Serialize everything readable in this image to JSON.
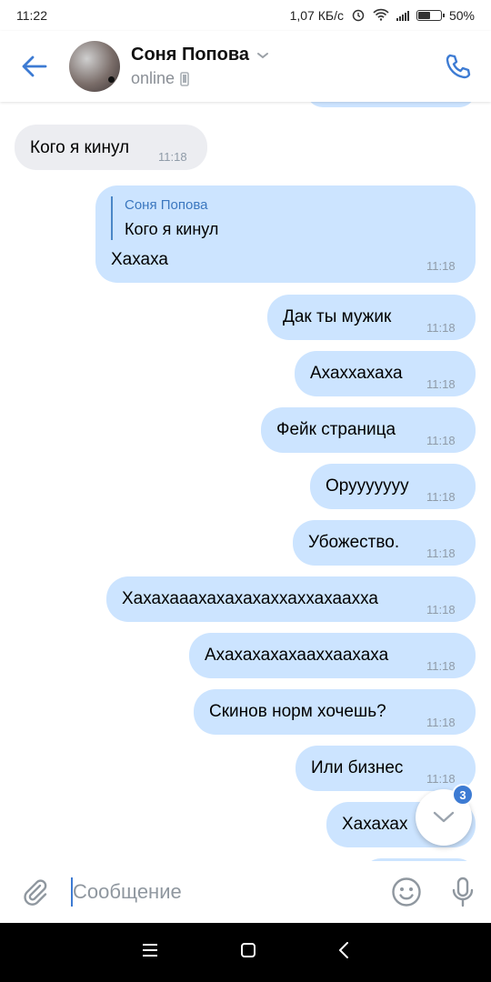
{
  "status_bar": {
    "time": "11:22",
    "speed": "1,07 КБ/с",
    "battery": "50%"
  },
  "header": {
    "name": "Соня Попова",
    "status": "online"
  },
  "messages": [
    {
      "text": "Кого я кинул",
      "time": "11:18",
      "direction": "in"
    },
    {
      "reply_name": "Соня Попова",
      "reply_text": "Кого я кинул",
      "text": "Хахаха",
      "time": "11:18",
      "direction": "out"
    },
    {
      "text": "Дак ты мужик",
      "time": "11:18",
      "direction": "out"
    },
    {
      "text": "Ахаххахаха",
      "time": "11:18",
      "direction": "out"
    },
    {
      "text": "Фейк страница",
      "time": "11:18",
      "direction": "out"
    },
    {
      "text": "Оруууууyy",
      "time": "11:18",
      "direction": "out"
    },
    {
      "text": "Убожество.",
      "time": "11:18",
      "direction": "out"
    },
    {
      "text": "Хахахааахахахахаххаххахаахха",
      "time": "11:18",
      "direction": "out"
    },
    {
      "text": "Ахахахахахааххаахаха",
      "time": "11:18",
      "direction": "out"
    },
    {
      "text": "Скинов норм хочешь?",
      "time": "11:18",
      "direction": "out"
    },
    {
      "text": "Или бизнес",
      "time": "11:18",
      "direction": "out"
    },
    {
      "text": "Хахахах",
      "direction": "out"
    }
  ],
  "scroll_button": {
    "unread_count": "3"
  },
  "composer": {
    "placeholder": "Сообщение"
  },
  "colors": {
    "accent": "#3d7bd3",
    "outgoing_bubble": "#cce4ff",
    "incoming_bubble": "#ecedf1"
  }
}
